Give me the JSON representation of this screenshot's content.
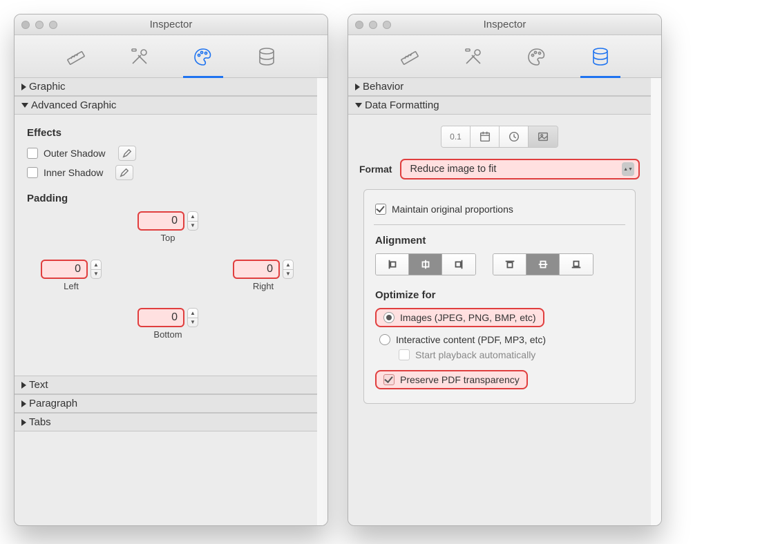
{
  "left": {
    "title": "Inspector",
    "sections": {
      "graphic": "Graphic",
      "advanced": "Advanced Graphic",
      "text": "Text",
      "paragraph": "Paragraph",
      "tabs": "Tabs"
    },
    "effects": {
      "heading": "Effects",
      "outer": "Outer Shadow",
      "inner": "Inner Shadow"
    },
    "padding": {
      "heading": "Padding",
      "top": {
        "value": "0",
        "label": "Top"
      },
      "left": {
        "value": "0",
        "label": "Left"
      },
      "right": {
        "value": "0",
        "label": "Right"
      },
      "bottom": {
        "value": "0",
        "label": "Bottom"
      }
    }
  },
  "right": {
    "title": "Inspector",
    "sections": {
      "behavior": "Behavior",
      "dataformatting": "Data Formatting"
    },
    "format": {
      "label": "Format",
      "value": "Reduce image to fit",
      "segs": [
        "0.1",
        "calendar",
        "clock",
        "image"
      ],
      "selected": "image"
    },
    "maintain": "Maintain original proportions",
    "alignment": {
      "heading": "Alignment",
      "h_selected": "center",
      "v_selected": "middle"
    },
    "optimize": {
      "heading": "Optimize for",
      "images": "Images (JPEG, PNG, BMP, etc)",
      "interactive": "Interactive content (PDF, MP3, etc)",
      "autoplay": "Start playback automatically",
      "selected": "images"
    },
    "preserve": "Preserve PDF transparency"
  }
}
